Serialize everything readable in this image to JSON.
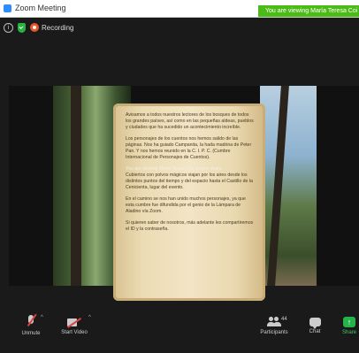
{
  "window": {
    "title": "Zoom Meeting",
    "viewing_banner": "You are viewing María Teresa Coi"
  },
  "status": {
    "recording_label": "Recording",
    "info_glyph": "i"
  },
  "scroll": {
    "paragraphs": [
      "Avisamos a todos nuestros lectores de los bosques de todos los grandes países, así como en las pequeñas aldeas, pueblos y ciudades que ha sucedido un acontecimiento increíble.",
      "Los personajes de los cuentos nos hemos salido de las páginas. Nos ha guiado Campanita, la hada madrina de Peter Pan. Y nos hemos reunido en la C. I. P. C. (Cumbre Internacional de Personajes de Cuentos).",
      "Cubiertos con polvos mágicos viajan por los aires desde los distintos puntos del tiempo y del espacio hasta el Castillo de la Cenicienta, lugar del evento.",
      "En el camino se nos han unido muchos personajes, ya que esta cumbre fue difundida por el genio de la Lámpara de Aladino vía Zoom.",
      "Si quieren saber de nosotros, más adelante les compartiremos el ID y la contraseña."
    ],
    "overlay_line": "You are viewing María Teresa Coi screen share"
  },
  "toolbar": {
    "unmute_label": "Unmute",
    "start_video_label": "Start Video",
    "participants_label": "Participants",
    "participants_count": "44",
    "chat_label": "Chat",
    "share_label": "Share",
    "caret": "^",
    "share_glyph": "↑"
  },
  "colors": {
    "banner_green": "#4cbb17",
    "share_green": "#26b34a",
    "recording_orange": "#e8562a",
    "shield_green": "#27b43e"
  }
}
